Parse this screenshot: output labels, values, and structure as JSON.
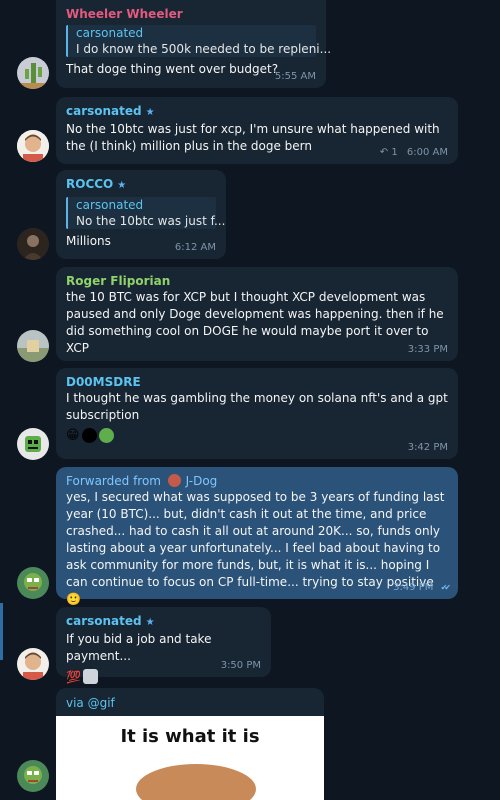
{
  "messages": [
    {
      "sender": "Wheeler Wheeler",
      "sender_color": "#e35a7e",
      "reply_name": "carsonated",
      "reply_text": "I do know the 500k needed to be repleni...",
      "text": "That doge thing went over budget?",
      "time": "5:55 AM",
      "avatar_icon": "cactus-avatar"
    },
    {
      "sender": "carsonated",
      "sender_color": "#5cc3f0",
      "text": "No the 10btc was just for xcp, I'm unsure what happened with the (I think) million plus in the doge bern",
      "time": "6:00 AM",
      "reply_count": "1",
      "avatar_icon": "person-avatar"
    },
    {
      "sender": "ROCCO",
      "sender_color": "#5cc3f0",
      "reply_name": "carsonated",
      "reply_text": "No the 10btc was just f...",
      "text": "Millions",
      "time": "6:12 AM",
      "avatar_icon": "dark-figure-avatar"
    },
    {
      "sender": "Roger Fliporian",
      "sender_color": "#8fd36a",
      "text": "the 10 BTC was for XCP but I thought XCP development was paused and only Doge development was happening. then if he did something cool on DOGE he would maybe port it over to XCP",
      "time": "3:33 PM",
      "avatar_icon": "landscape-avatar"
    },
    {
      "sender": "D00MSDRE",
      "sender_color": "#5cc3f0",
      "text": "I thought he was gambling the money on solana nft's and a gpt subscription",
      "time": "3:42 PM",
      "avatar_icon": "green-robot-avatar"
    },
    {
      "forward_label": "Forwarded from",
      "forward_from": "J-Dog",
      "text": "yes, I secured what was supposed to be 3 years of funding last year (10 BTC)... but, didn't cash it out at the time, and price crashed... had to cash it all out at around 20K... so, funds only lasting about a year unfortunately... I feel bad about having to ask community for more funds, but, it is what it is... hoping I can continue to focus on CP full-time... trying to stay positive 🙂",
      "time": "3:49 PM",
      "avatar_icon": "pepe-avatar"
    },
    {
      "sender": "carsonated",
      "sender_color": "#5cc3f0",
      "text": "If you bid a job and take payment...",
      "time": "3:50 PM",
      "avatar_icon": "person-avatar"
    }
  ],
  "gif": {
    "via": "via @gif",
    "caption": "It is what it is"
  },
  "icons": {
    "star": "★",
    "reply_arrow": "↶",
    "double_check": "✔✔",
    "emoji_100": "💯",
    "emoji_grin": "😁",
    "emoji_smile": "🙂"
  }
}
